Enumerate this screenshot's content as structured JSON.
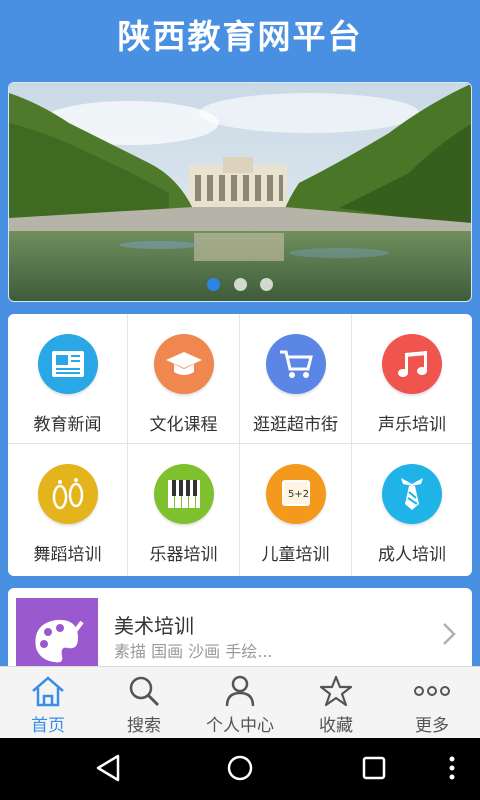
{
  "app": {
    "title": "陕西教育网平台"
  },
  "banner": {
    "dots": 3,
    "active_dot": 0
  },
  "grid": {
    "items": [
      {
        "label": "教育新闻",
        "icon": "newspaper-icon",
        "color": "#29a7e6"
      },
      {
        "label": "文化课程",
        "icon": "graduation-cap-icon",
        "color": "#f0874f"
      },
      {
        "label": "逛逛超市街",
        "icon": "shopping-cart-icon",
        "color": "#5b86e5"
      },
      {
        "label": "声乐培训",
        "icon": "music-notes-icon",
        "color": "#f0544f"
      },
      {
        "label": "舞蹈培训",
        "icon": "footprints-icon",
        "color": "#e3b41c"
      },
      {
        "label": "乐器培训",
        "icon": "piano-keys-icon",
        "color": "#7dc12f"
      },
      {
        "label": "儿童培训",
        "icon": "chalkboard-icon",
        "color": "#f39a1e"
      },
      {
        "label": "成人培训",
        "icon": "necktie-icon",
        "color": "#1fb3e8"
      }
    ]
  },
  "feature_card": {
    "title": "美术培训",
    "subtitle": "素描 国画 沙画 手绘...",
    "icon": "palette-icon",
    "color": "#9b59d0"
  },
  "tabbar": {
    "tabs": [
      {
        "label": "首页",
        "icon": "home-icon",
        "active": true
      },
      {
        "label": "搜索",
        "icon": "search-icon",
        "active": false
      },
      {
        "label": "个人中心",
        "icon": "user-icon",
        "active": false
      },
      {
        "label": "收藏",
        "icon": "star-icon",
        "active": false
      },
      {
        "label": "更多",
        "icon": "more-icon",
        "active": false
      }
    ]
  },
  "colors": {
    "header": "#4a90e2",
    "tab_active": "#3a8ee6"
  }
}
